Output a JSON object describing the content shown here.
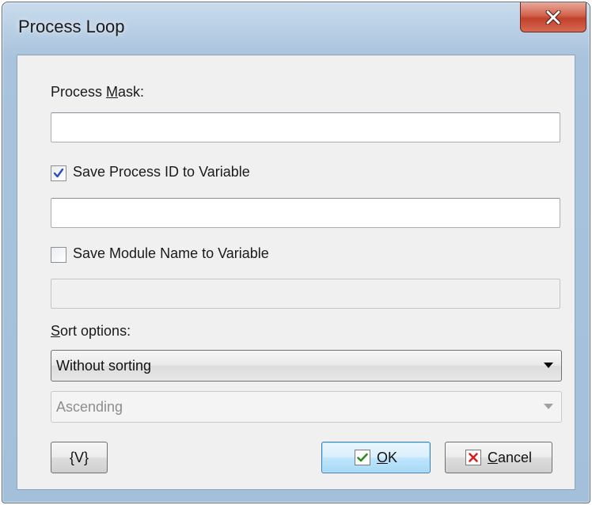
{
  "window": {
    "title": "Process Loop"
  },
  "process_mask": {
    "label_prefix": "Process ",
    "label_accel": "M",
    "label_suffix": "ask:",
    "value": ""
  },
  "save_process_id": {
    "checked": true,
    "label": "Save Process ID to Variable",
    "value": ""
  },
  "save_module_name": {
    "checked": false,
    "label": "Save Module Name to Variable",
    "value": ""
  },
  "sort": {
    "label_accel": "S",
    "label_rest": "ort options:",
    "primary_selected": "Without sorting",
    "secondary_selected": "Ascending"
  },
  "buttons": {
    "variables": "{V}",
    "ok_accel": "O",
    "ok_rest": "K",
    "cancel_accel": "C",
    "cancel_rest": "ancel"
  },
  "colors": {
    "check_green": "#2f8a1f",
    "cancel_red": "#d42020",
    "close_red": "#c0412b"
  },
  "icons": {
    "close": "close-icon",
    "checkmark": "checkmark-icon",
    "ok": "ok-check-icon",
    "cancel": "cancel-x-icon",
    "dropdown": "chevron-down-icon"
  }
}
